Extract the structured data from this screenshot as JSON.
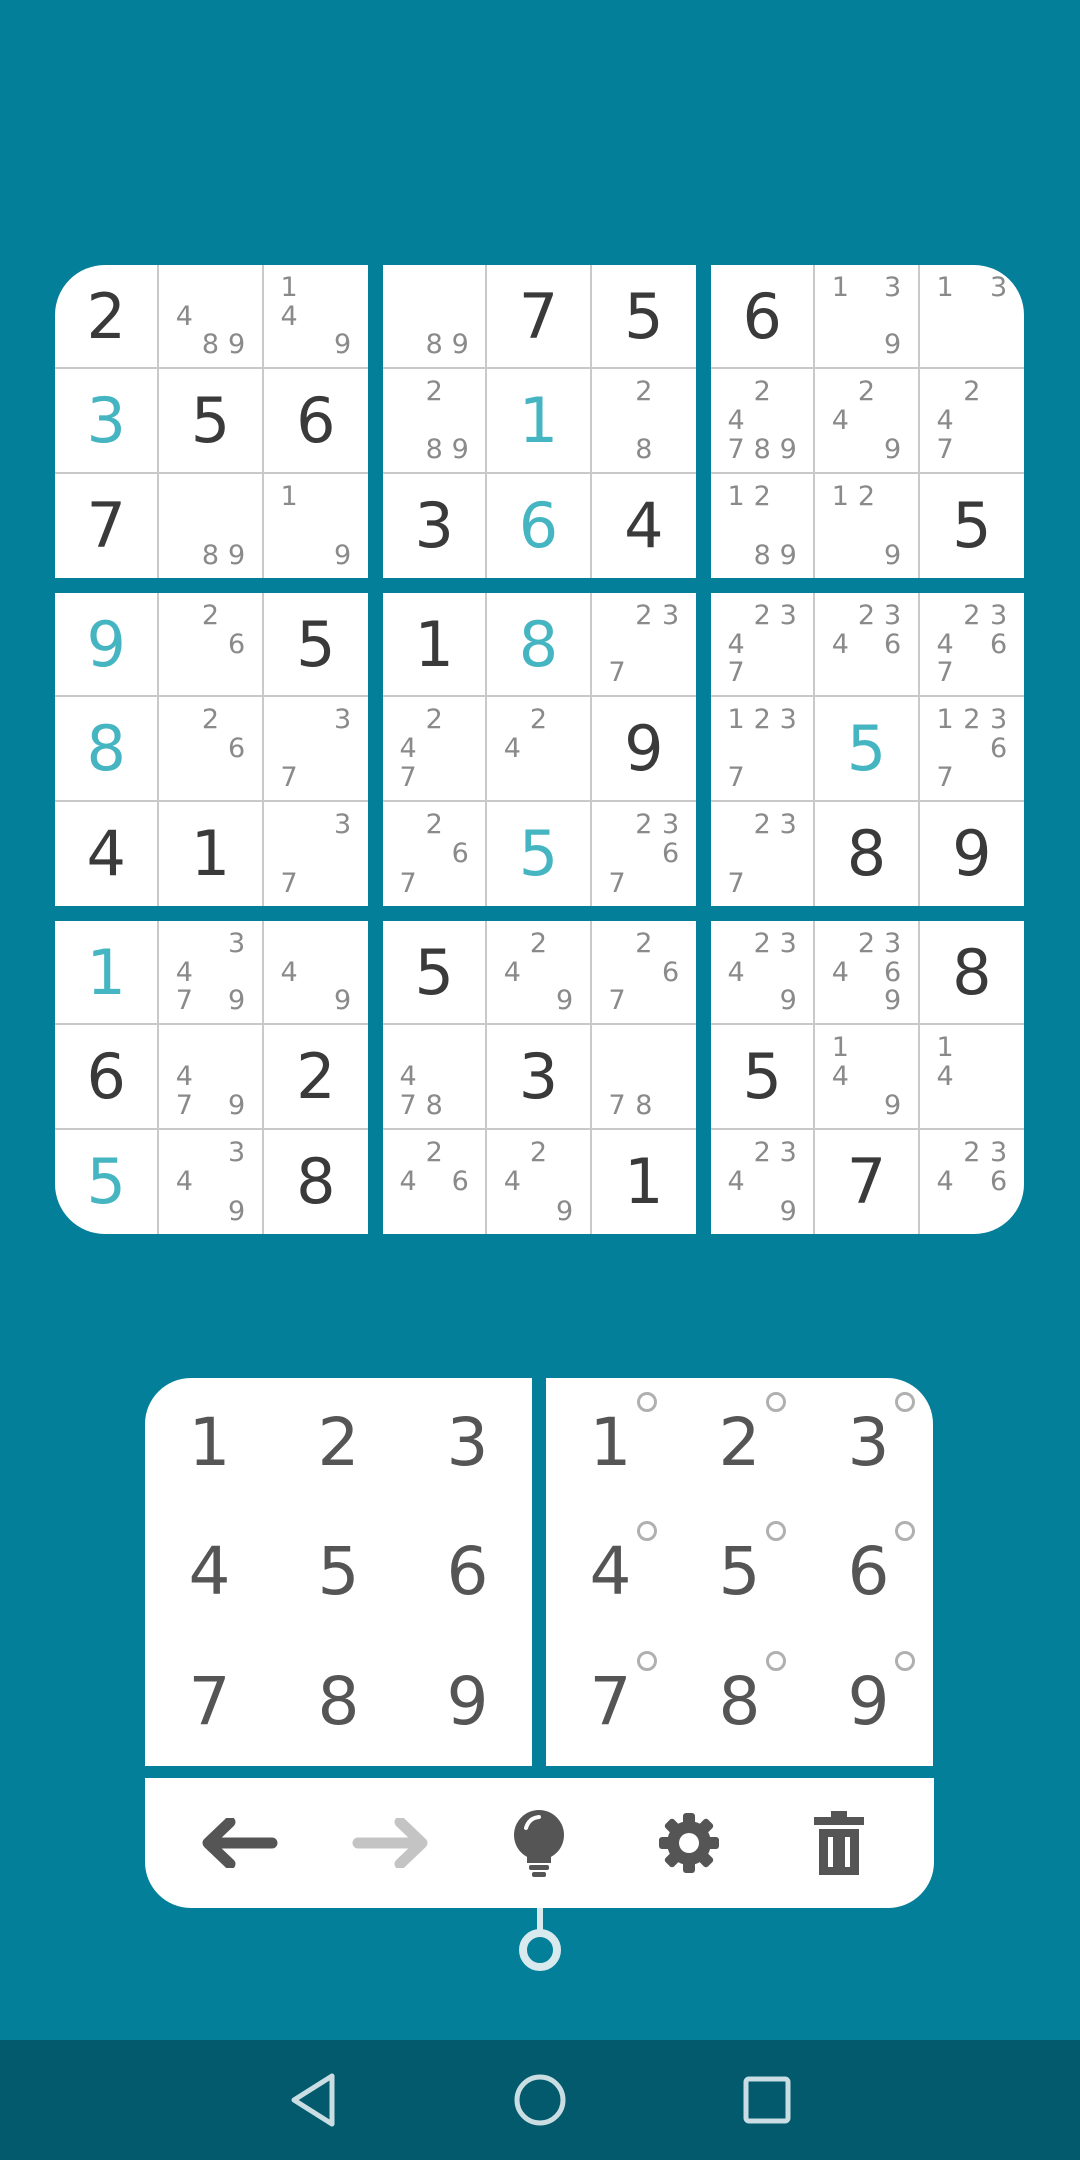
{
  "board": {
    "given_color": "#3a3a3a",
    "user_color": "#46b5c2",
    "rows": [
      [
        {
          "v": "2",
          "t": "g"
        },
        {
          "n": "489"
        },
        {
          "n": "149"
        },
        {
          "n": "89"
        },
        {
          "v": "7",
          "t": "g"
        },
        {
          "v": "5",
          "t": "g"
        },
        {
          "v": "6",
          "t": "g"
        },
        {
          "n": "139"
        },
        {
          "n": "13"
        }
      ],
      [
        {
          "v": "3",
          "t": "u"
        },
        {
          "v": "5",
          "t": "g"
        },
        {
          "v": "6",
          "t": "g"
        },
        {
          "n": "289"
        },
        {
          "v": "1",
          "t": "u"
        },
        {
          "n": "28"
        },
        {
          "n": "24789"
        },
        {
          "n": "249"
        },
        {
          "n": "247"
        }
      ],
      [
        {
          "v": "7",
          "t": "g"
        },
        {
          "n": "89"
        },
        {
          "n": "19"
        },
        {
          "v": "3",
          "t": "g"
        },
        {
          "v": "6",
          "t": "u"
        },
        {
          "v": "4",
          "t": "g"
        },
        {
          "n": "1289"
        },
        {
          "n": "129"
        },
        {
          "v": "5",
          "t": "g"
        }
      ],
      [
        {
          "v": "9",
          "t": "u"
        },
        {
          "n": "26"
        },
        {
          "v": "5",
          "t": "g"
        },
        {
          "v": "1",
          "t": "g"
        },
        {
          "v": "8",
          "t": "u"
        },
        {
          "n": "237"
        },
        {
          "n": "2347"
        },
        {
          "n": "2346"
        },
        {
          "n": "23467"
        }
      ],
      [
        {
          "v": "8",
          "t": "u"
        },
        {
          "n": "26"
        },
        {
          "n": "37"
        },
        {
          "n": "247"
        },
        {
          "n": "24"
        },
        {
          "v": "9",
          "t": "g"
        },
        {
          "n": "1237"
        },
        {
          "v": "5",
          "t": "u"
        },
        {
          "n": "12367"
        }
      ],
      [
        {
          "v": "4",
          "t": "g"
        },
        {
          "v": "1",
          "t": "g"
        },
        {
          "n": "37"
        },
        {
          "n": "267"
        },
        {
          "v": "5",
          "t": "u"
        },
        {
          "n": "2367"
        },
        {
          "n": "237"
        },
        {
          "v": "8",
          "t": "g"
        },
        {
          "v": "9",
          "t": "g"
        }
      ],
      [
        {
          "v": "1",
          "t": "u"
        },
        {
          "n": "3479"
        },
        {
          "n": "49"
        },
        {
          "v": "5",
          "t": "g"
        },
        {
          "n": "249"
        },
        {
          "n": "267"
        },
        {
          "n": "2349"
        },
        {
          "n": "23469"
        },
        {
          "v": "8",
          "t": "g"
        }
      ],
      [
        {
          "v": "6",
          "t": "g"
        },
        {
          "n": "479"
        },
        {
          "v": "2",
          "t": "g"
        },
        {
          "n": "478"
        },
        {
          "v": "3",
          "t": "g"
        },
        {
          "n": "78"
        },
        {
          "v": "5",
          "t": "g"
        },
        {
          "n": "149"
        },
        {
          "n": "14"
        }
      ],
      [
        {
          "v": "5",
          "t": "u"
        },
        {
          "n": "349"
        },
        {
          "v": "8",
          "t": "g"
        },
        {
          "n": "246"
        },
        {
          "n": "249"
        },
        {
          "v": "1",
          "t": "g"
        },
        {
          "n": "2349"
        },
        {
          "v": "7",
          "t": "g"
        },
        {
          "n": "2346"
        }
      ]
    ]
  },
  "digit_pad": {
    "keys": [
      "1",
      "2",
      "3",
      "4",
      "5",
      "6",
      "7",
      "8",
      "9"
    ]
  },
  "notes_pad": {
    "keys": [
      "1",
      "2",
      "3",
      "4",
      "5",
      "6",
      "7",
      "8",
      "9"
    ]
  },
  "toolbar": {
    "undo_icon": "arrow-left-icon",
    "redo_icon": "arrow-right-icon",
    "hint_icon": "lightbulb-icon",
    "settings_icon": "gear-icon",
    "clear_icon": "trash-icon",
    "active_icon_color": "#555555",
    "disabled_icon_color": "#c4c4c4"
  },
  "colors": {
    "background": "#037f9a",
    "navbar": "#035a6d"
  }
}
